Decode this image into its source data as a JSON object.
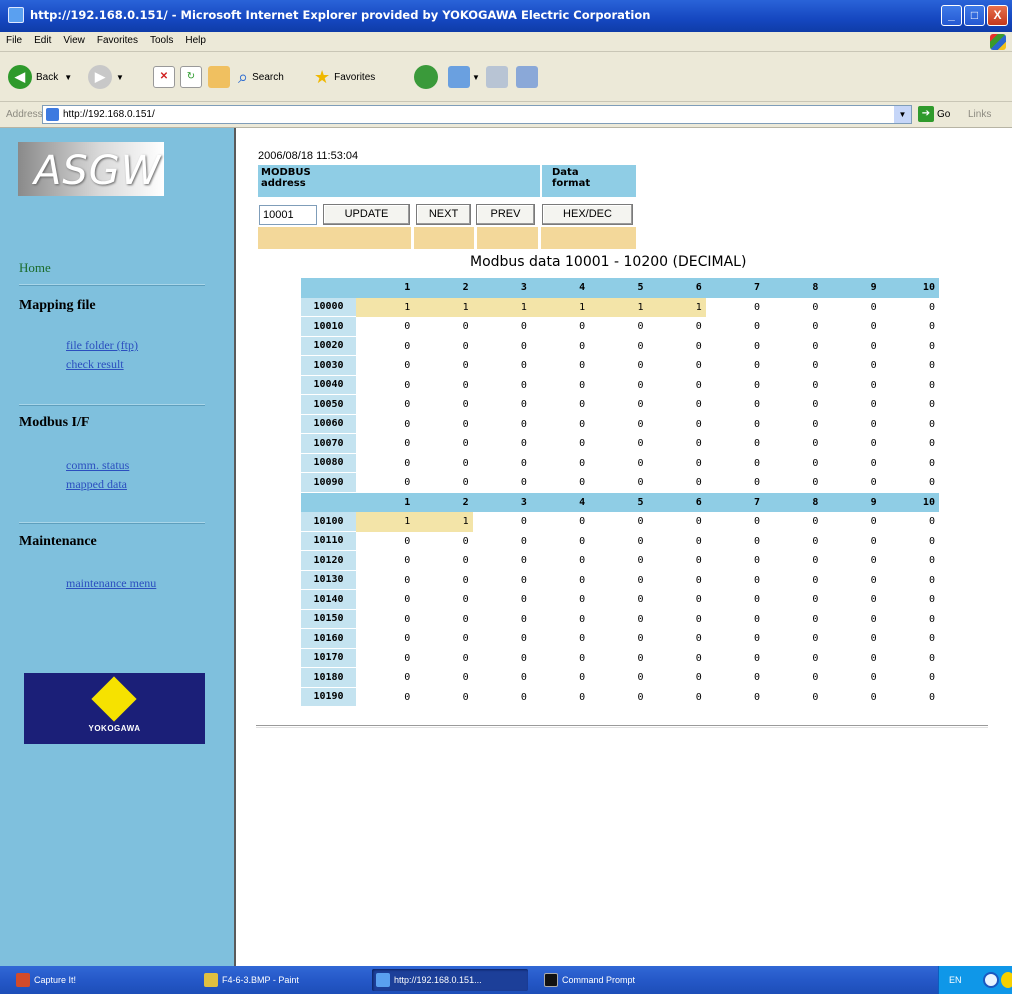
{
  "window": {
    "title": "http://192.168.0.151/ - Microsoft Internet Explorer provided by YOKOGAWA Electric Corporation",
    "minimize": "_",
    "maximize": "□",
    "close": "X"
  },
  "menu": [
    "File",
    "Edit",
    "View",
    "Favorites",
    "Tools",
    "Help"
  ],
  "toolbar": {
    "back_label": "Back",
    "search_label": "Search",
    "favorites_label": "Favorites"
  },
  "address_bar": {
    "label": "Address",
    "url": "http://192.168.0.151/",
    "go_label": "Go",
    "links_label": "Links"
  },
  "sidebar": {
    "logo_text": "ASGW",
    "home": "Home",
    "sections": [
      {
        "heading": "Mapping file",
        "links": [
          "file folder (ftp)",
          "check result"
        ]
      },
      {
        "heading": "Modbus I/F",
        "links": [
          "comm. status",
          "mapped data"
        ]
      },
      {
        "heading": "Maintenance",
        "links": [
          "maintenance menu"
        ]
      }
    ],
    "brand": "YOKOGAWA"
  },
  "main": {
    "timestamp": "2006/08/18 11:53:04",
    "modbus_address_label_1": "MODBUS",
    "modbus_address_label_2": "address",
    "data_format_label_1": "Data",
    "data_format_label_2": "format",
    "address_value": "10001",
    "buttons": {
      "update": "UPDATE",
      "next": "NEXT",
      "prev": "PREV",
      "hexdec": "HEX/DEC"
    },
    "caption": "Modbus data 10001 - 10200 (DECIMAL)",
    "columns": [
      "1",
      "2",
      "3",
      "4",
      "5",
      "6",
      "7",
      "8",
      "9",
      "10"
    ],
    "blocks": [
      {
        "rows": [
          {
            "addr": "10000",
            "values": [
              "1",
              "1",
              "1",
              "1",
              "1",
              "1",
              "0",
              "0",
              "0",
              "0"
            ]
          },
          {
            "addr": "10010",
            "values": [
              "0",
              "0",
              "0",
              "0",
              "0",
              "0",
              "0",
              "0",
              "0",
              "0"
            ]
          },
          {
            "addr": "10020",
            "values": [
              "0",
              "0",
              "0",
              "0",
              "0",
              "0",
              "0",
              "0",
              "0",
              "0"
            ]
          },
          {
            "addr": "10030",
            "values": [
              "0",
              "0",
              "0",
              "0",
              "0",
              "0",
              "0",
              "0",
              "0",
              "0"
            ]
          },
          {
            "addr": "10040",
            "values": [
              "0",
              "0",
              "0",
              "0",
              "0",
              "0",
              "0",
              "0",
              "0",
              "0"
            ]
          },
          {
            "addr": "10050",
            "values": [
              "0",
              "0",
              "0",
              "0",
              "0",
              "0",
              "0",
              "0",
              "0",
              "0"
            ]
          },
          {
            "addr": "10060",
            "values": [
              "0",
              "0",
              "0",
              "0",
              "0",
              "0",
              "0",
              "0",
              "0",
              "0"
            ]
          },
          {
            "addr": "10070",
            "values": [
              "0",
              "0",
              "0",
              "0",
              "0",
              "0",
              "0",
              "0",
              "0",
              "0"
            ]
          },
          {
            "addr": "10080",
            "values": [
              "0",
              "0",
              "0",
              "0",
              "0",
              "0",
              "0",
              "0",
              "0",
              "0"
            ]
          },
          {
            "addr": "10090",
            "values": [
              "0",
              "0",
              "0",
              "0",
              "0",
              "0",
              "0",
              "0",
              "0",
              "0"
            ]
          }
        ]
      },
      {
        "rows": [
          {
            "addr": "10100",
            "values": [
              "1",
              "1",
              "0",
              "0",
              "0",
              "0",
              "0",
              "0",
              "0",
              "0"
            ]
          },
          {
            "addr": "10110",
            "values": [
              "0",
              "0",
              "0",
              "0",
              "0",
              "0",
              "0",
              "0",
              "0",
              "0"
            ]
          },
          {
            "addr": "10120",
            "values": [
              "0",
              "0",
              "0",
              "0",
              "0",
              "0",
              "0",
              "0",
              "0",
              "0"
            ]
          },
          {
            "addr": "10130",
            "values": [
              "0",
              "0",
              "0",
              "0",
              "0",
              "0",
              "0",
              "0",
              "0",
              "0"
            ]
          },
          {
            "addr": "10140",
            "values": [
              "0",
              "0",
              "0",
              "0",
              "0",
              "0",
              "0",
              "0",
              "0",
              "0"
            ]
          },
          {
            "addr": "10150",
            "values": [
              "0",
              "0",
              "0",
              "0",
              "0",
              "0",
              "0",
              "0",
              "0",
              "0"
            ]
          },
          {
            "addr": "10160",
            "values": [
              "0",
              "0",
              "0",
              "0",
              "0",
              "0",
              "0",
              "0",
              "0",
              "0"
            ]
          },
          {
            "addr": "10170",
            "values": [
              "0",
              "0",
              "0",
              "0",
              "0",
              "0",
              "0",
              "0",
              "0",
              "0"
            ]
          },
          {
            "addr": "10180",
            "values": [
              "0",
              "0",
              "0",
              "0",
              "0",
              "0",
              "0",
              "0",
              "0",
              "0"
            ]
          },
          {
            "addr": "10190",
            "values": [
              "0",
              "0",
              "0",
              "0",
              "0",
              "0",
              "0",
              "0",
              "0",
              "0"
            ]
          }
        ]
      }
    ]
  },
  "taskbar": {
    "tasks": [
      "Capture It!",
      "F4-6-3.BMP - Paint",
      "http://192.168.0.151...",
      "Command Prompt"
    ],
    "lang": "EN"
  },
  "colors": {
    "sidebar_bg": "#7fc0dd",
    "header_bg": "#8fcde5",
    "highlight": "#f3e4a8",
    "tan_bar": "#f3d89a",
    "title_bar": "#1547c0"
  }
}
